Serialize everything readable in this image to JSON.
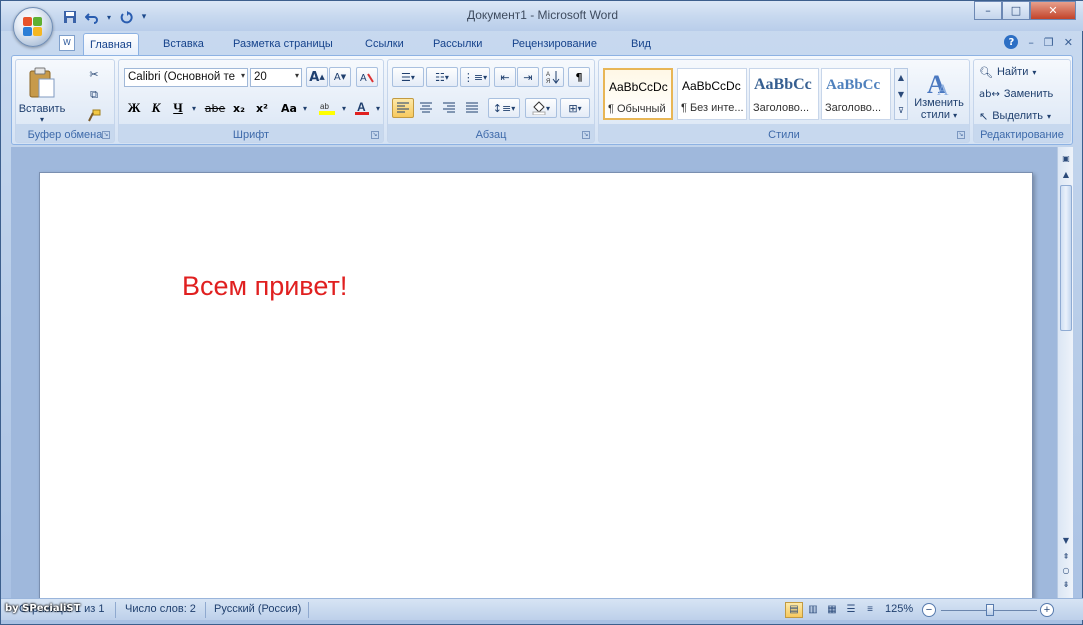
{
  "window": {
    "title": "Документ1 - Microsoft Word",
    "controls": {
      "minimize": "–",
      "maximize": "□",
      "close": "✕"
    }
  },
  "quick_access": {
    "save_icon": "save-icon",
    "undo_icon": "undo-icon",
    "redo_icon": "redo-icon",
    "customize": "▾"
  },
  "tabs": [
    {
      "label": "Главная",
      "active": true
    },
    {
      "label": "Вставка"
    },
    {
      "label": "Разметка страницы"
    },
    {
      "label": "Ссылки"
    },
    {
      "label": "Рассылки"
    },
    {
      "label": "Рецензирование"
    },
    {
      "label": "Вид"
    }
  ],
  "ribbon": {
    "clipboard": {
      "label": "Буфер обмена",
      "paste_label": "Вставить"
    },
    "font": {
      "label": "Шрифт",
      "font_name": "Calibri (Основной те",
      "font_size": "20",
      "bold": "Ж",
      "italic": "К",
      "underline": "Ч",
      "strike": "abe",
      "subscript": "x₂",
      "superscript": "x²",
      "change_case": "Aa",
      "grow": "A",
      "shrink": "A"
    },
    "paragraph": {
      "label": "Абзац",
      "pilcrow": "¶"
    },
    "styles": {
      "label": "Стили",
      "items": [
        {
          "sample": "AaBbCcDc",
          "name": "¶ Обычный",
          "selected": true
        },
        {
          "sample": "AaBbCcDc",
          "name": "¶ Без инте..."
        },
        {
          "sample": "AaBbCс",
          "name": "Заголово..."
        },
        {
          "sample": "AaBbCc",
          "name": "Заголово..."
        }
      ],
      "change_styles_line1": "Изменить",
      "change_styles_line2": "стили"
    },
    "editing": {
      "label": "Редактирование",
      "find": "Найти",
      "replace": "Заменить",
      "select": "Выделить"
    }
  },
  "document": {
    "text": "Всем привет!",
    "text_color": "#e02020"
  },
  "statusbar": {
    "page": "Страница: 1 из 1",
    "words": "Число слов: 2",
    "language": "Русский (Россия)",
    "zoom": "125%",
    "zoom_level_percent": 125
  },
  "watermark": "by SPecialiST"
}
